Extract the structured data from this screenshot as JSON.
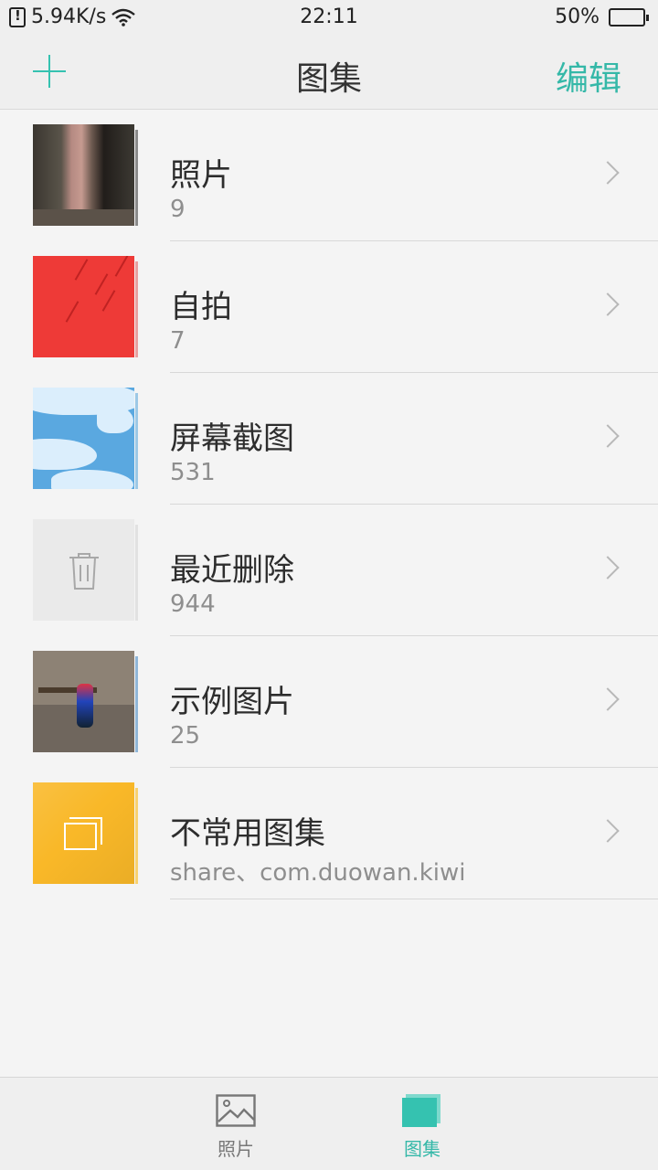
{
  "status_bar": {
    "speed": "5.94K/s",
    "time": "22:11",
    "battery_percent": "50%",
    "battery_level": 0.5,
    "icons": [
      "sim-icon",
      "wifi-icon",
      "battery-icon"
    ]
  },
  "header": {
    "title": "图集",
    "edit_label": "编辑",
    "add_icon": "plus-icon",
    "accent_color": "#35b8a8"
  },
  "albums": [
    {
      "title": "照片",
      "count": "9"
    },
    {
      "title": "自拍",
      "count": "7"
    },
    {
      "title": "屏幕截图",
      "count": "531"
    },
    {
      "title": "最近删除",
      "count": "944"
    },
    {
      "title": "示例图片",
      "count": "25"
    },
    {
      "title": "不常用图集",
      "count": "share、com.duowan.kiwi"
    }
  ],
  "bottom_nav": {
    "photos_label": "照片",
    "albums_label": "图集",
    "active": "图集"
  }
}
